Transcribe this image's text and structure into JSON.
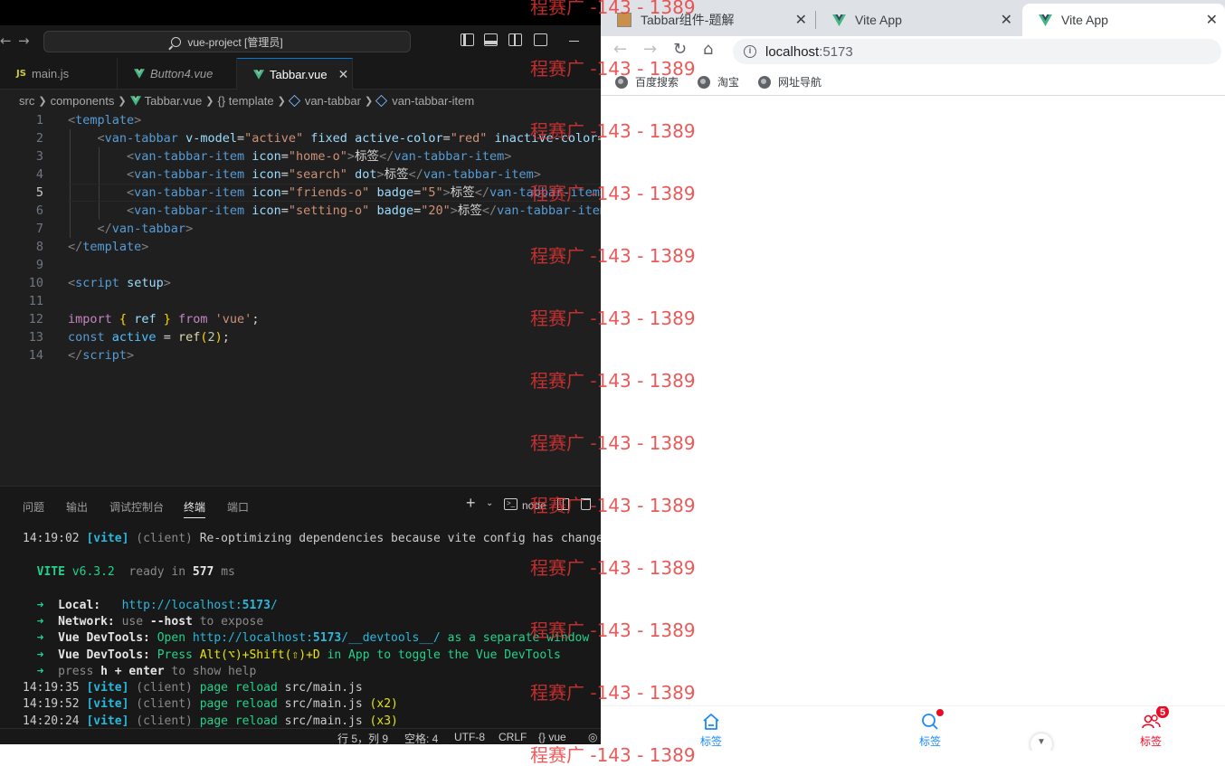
{
  "colors": {
    "vscode_bg": "#1f1f1f",
    "accent_blue": "#0078d4",
    "vant_active": "#1989fa",
    "vant_inactive": "#ee0a24",
    "watermark": "#e83434"
  },
  "vscode": {
    "search_label": "vue-project [管理员]",
    "tabs": [
      {
        "icon": "js-icon",
        "badge": "JS",
        "label": "main.js"
      },
      {
        "icon": "vue-icon",
        "label": "Button4.vue"
      },
      {
        "icon": "vue-icon",
        "label": "Tabbar.vue",
        "close": "✕"
      }
    ],
    "breadcrumb": [
      "src",
      "components",
      "Tabbar.vue",
      "{} template",
      "van-tabbar",
      "van-tabbar-item"
    ],
    "line_numbers": [
      "1",
      "2",
      "3",
      "4",
      "5",
      "6",
      "7",
      "8",
      "9",
      "10",
      "11",
      "12",
      "13",
      "14"
    ],
    "code": {
      "l3_text": "标签",
      "l4_text": "标签",
      "l5_text": "标签",
      "l6_text": "标签"
    },
    "panel_tabs": [
      "问题",
      "输出",
      "调试控制台",
      "终端",
      "端口"
    ],
    "panel_node_label": "node",
    "terminal": {
      "l1_time": "14:19:02",
      "l1_tag": "[vite]",
      "l1_client": "(client)",
      "l1_msg": "Re-optimizing dependencies because vite config has changed",
      "vite_name": "VITE",
      "vite_ver": "v6.3.2",
      "ready_a": "ready in",
      "ready_ms": "577",
      "ready_b": "ms",
      "arrow": "➜",
      "local_label": "Local:",
      "local_url_a": "http://localhost:",
      "local_port": "5173",
      "local_url_b": "/",
      "network_label": "Network:",
      "network_a": "use",
      "network_flag": "--host",
      "network_b": "to expose",
      "devtools_label": "Vue DevTools:",
      "devtools1_a": "Open",
      "devtools1_url_a": "http://localhost:",
      "devtools1_port": "5173",
      "devtools1_url_b": "/__devtools__/",
      "devtools1_b": "as a separate window",
      "devtools2_a": "Press",
      "devtools2_keys": "Alt(⌥)+Shift(⇧)+D",
      "devtools2_b": "in App to toggle the Vue DevTools",
      "help_a": "press",
      "help_key": "h + enter",
      "help_b": "to show help",
      "reloads": [
        {
          "time": "14:19:35",
          "tag": "[vite]",
          "client": "(client)",
          "msg": "page reload",
          "file": "src/main.js",
          "count": ""
        },
        {
          "time": "14:19:52",
          "tag": "[vite]",
          "client": "(client)",
          "msg": "page reload",
          "file": "src/main.js",
          "count": "(x2)"
        },
        {
          "time": "14:20:24",
          "tag": "[vite]",
          "client": "(client)",
          "msg": "page reload",
          "file": "src/main.js",
          "count": "(x3)"
        }
      ]
    },
    "status": {
      "position": "行 5，列 9",
      "spaces": "空格: 4",
      "encoding": "UTF-8",
      "eol": "CRLF",
      "language": "{} vue"
    }
  },
  "browser": {
    "tabs": [
      {
        "label": "Tabbar组件-题解",
        "icon": "image-favicon"
      },
      {
        "label": "Vite App",
        "icon": "vue-favicon"
      },
      {
        "label": "Vite App",
        "icon": "vue-favicon"
      }
    ],
    "tab_close": "✕",
    "address": {
      "host": "localhost",
      "port": ":5173"
    },
    "bookmarks": [
      "百度搜索",
      "淘宝",
      "网址导航"
    ],
    "tabbar": {
      "items": [
        {
          "label": "标签",
          "icon": "home-o",
          "active": true
        },
        {
          "label": "标签",
          "icon": "search",
          "dot": true
        },
        {
          "label": "标签",
          "icon": "friends-o",
          "badge": "5"
        }
      ]
    }
  },
  "watermark": "程赛广 -143 - 1389"
}
